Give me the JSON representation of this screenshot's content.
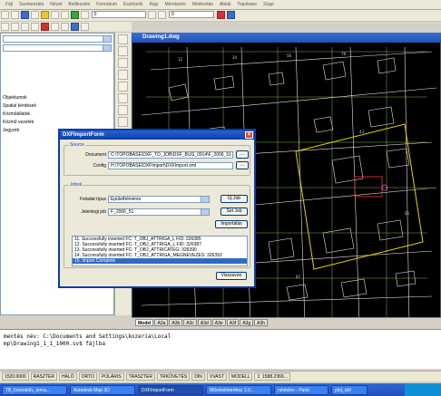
{
  "menubar": [
    "Fájl",
    "Szerkesztés",
    "Nézet",
    "Beillesztés",
    "Formátum",
    "Eszközök",
    "Rajz",
    "Méretezés",
    "Módosítás",
    "Ablak",
    "Topobase",
    "Súgó"
  ],
  "toolbar": {
    "layer_value": "0",
    "zoom_value": "0"
  },
  "left_panel": {
    "rows": [
      "",
      "",
      "",
      "",
      "",
      "Objektumok",
      "Spatial kérdések",
      "Közműállatok",
      "Közmű vezeték",
      "Jegyzék",
      "",
      ""
    ]
  },
  "document": {
    "title": "Drawing1.dwg"
  },
  "layout_tabs": [
    "Model",
    "A3a",
    "A3b",
    "A3c",
    "A3d",
    "A3e",
    "A3f",
    "A3g",
    "A3h"
  ],
  "dialog": {
    "title": "DXFImportForm",
    "source_group": "Source",
    "document_label": "Document",
    "document_value": "C:\\TOPOBASE\\DXF_TO_JOB\\DXF_BUG_0914\\F_2006_51",
    "config_label": "Config",
    "config_value": "H:\\TOPOBASE\\DXFImport\\DXFImport.xml",
    "browse_doc": "...",
    "browse_cfg": "...",
    "jobs_group": "Jobok",
    "feladat_label": "Feladat típus",
    "feladat_value": "Épületfelmérés",
    "jelenlegi_label": "Jelenlegi job",
    "jelenlegi_value": "F_2006_51",
    "job_button": "Új Job",
    "set_job_button": "Set Job",
    "import_button": "Importálás",
    "log_lines": [
      "11. Successfully inserted FC: T_OBJ_ATTRIGA_L FID: 326385",
      "12. Successfully inserted FC: T_OBJ_ATTRIGA_L FID: 326387",
      "13. Successfully inserted FC: T_OBJ_ATTRICATEG: 326390",
      "14. Successfully inserted FC: T_OBJ_ATTRIGA_MEGNEVEZES: 326393",
      "15. Import Complete"
    ],
    "close_button": "Visszavon"
  },
  "command_line": {
    "line1": "mentés név: C:\\Documents and Settings\\kozeria\\Local",
    "line2": "mp\\Drawing1_1_1_1000.sv$ fájlba"
  },
  "statusbar": [
    "1520.0000",
    "RASZTER",
    "HALÓ",
    "ORTO",
    "POLÁRIS",
    "TRASZTER",
    "TRKÖVETÉS",
    "DIN",
    "VVAST",
    "MODELL",
    "1: 1588.2369..."
  ],
  "taskbar": [
    "TB_futonaktív_tema...",
    "Autodesk Map 3D",
    "DXFImportForm",
    "Műveletinterfész 1.0...",
    "névtelen - Paint",
    "plot_def"
  ]
}
